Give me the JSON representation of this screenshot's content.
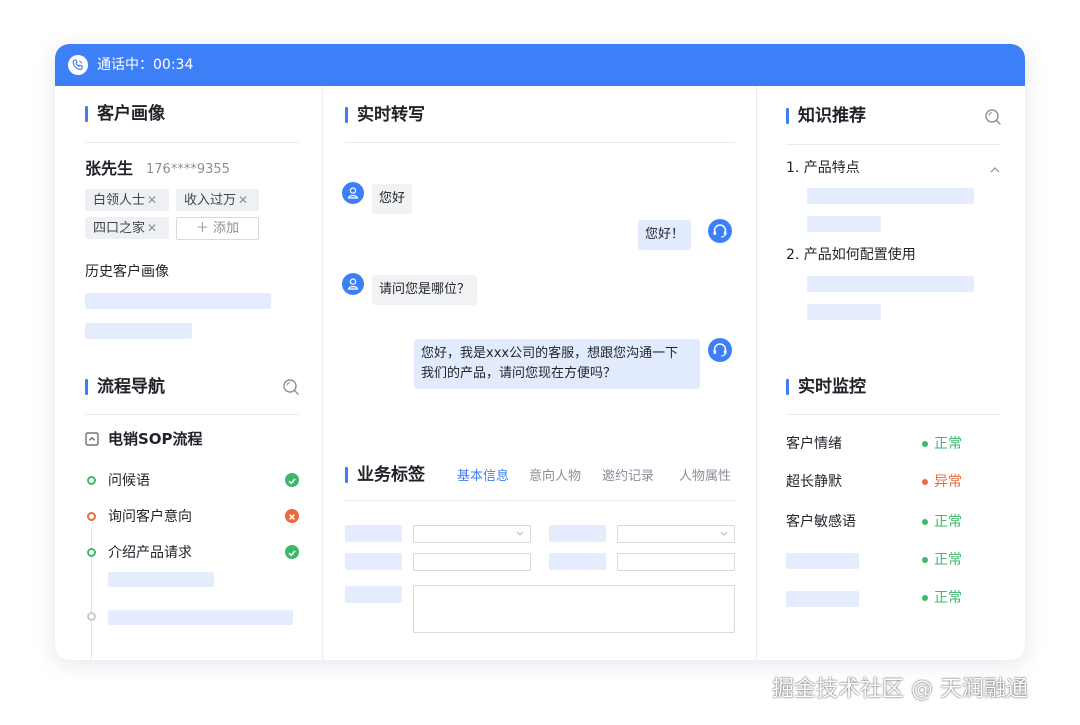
{
  "titlebar": {
    "call_status": "通话中：00:34"
  },
  "customer_profile": {
    "title": "客户画像",
    "name": "张先生",
    "phone": "176****9355",
    "tags": [
      {
        "label": "白领人士"
      },
      {
        "label": "收入过万"
      },
      {
        "label": "四口之家"
      }
    ],
    "tag_remove_glyph": "✕",
    "add_label": "＋ 添加",
    "history_label": "历史客户画像"
  },
  "flow_nav": {
    "title": "流程导航",
    "flow_name": "电销SOP流程",
    "steps": [
      {
        "label": "问候语",
        "status": "done"
      },
      {
        "label": "询问客户意向",
        "status": "failed"
      },
      {
        "label": "介绍产品请求",
        "status": "done"
      }
    ]
  },
  "transcript": {
    "title": "实时转写",
    "messages": [
      {
        "role": "customer",
        "text": "您好"
      },
      {
        "role": "agent",
        "text": "您好！"
      },
      {
        "role": "customer",
        "text": "请问您是哪位？"
      },
      {
        "role": "agent",
        "line1": "您好，我是xxx公司的客服，想跟您沟通一下",
        "line2": "我们的产品，请问您现在方便吗？"
      }
    ]
  },
  "business_tags": {
    "title": "业务标签",
    "tabs": [
      {
        "label": "基本信息",
        "active": true
      },
      {
        "label": "意向人物",
        "active": false
      },
      {
        "label": "邀约记录",
        "active": false
      },
      {
        "label": "人物属性",
        "active": false
      }
    ]
  },
  "knowledge": {
    "title": "知识推荐",
    "items": [
      {
        "label": "1. 产品特点",
        "expanded": true
      },
      {
        "label": "2. 产品如何配置使用",
        "expanded": false
      }
    ]
  },
  "monitor": {
    "title": "实时监控",
    "rows": [
      {
        "label": "客户情绪",
        "status": "正常",
        "state": "ok"
      },
      {
        "label": "超长静默",
        "status": "异常",
        "state": "warn"
      },
      {
        "label": "客户敏感语",
        "status": "正常",
        "state": "ok"
      },
      {
        "label": "",
        "status": "正常",
        "state": "ok"
      },
      {
        "label": "",
        "status": "正常",
        "state": "ok"
      }
    ]
  },
  "colors": {
    "accent": "#3d7ff6",
    "ok": "#3fb86b",
    "warn": "#ea6b3f",
    "skeleton": "#e4ecfd"
  },
  "icons": {
    "call": "phone-call-icon",
    "search": "search-icon",
    "collapse": "collapse-square-icon",
    "chevron_up": "chevron-up-icon",
    "chevron_down": "chevron-down-icon",
    "user_avatar": "user-icon",
    "agent_avatar": "headset-icon"
  },
  "watermark": "掘金技术社区 @ 天润融通"
}
